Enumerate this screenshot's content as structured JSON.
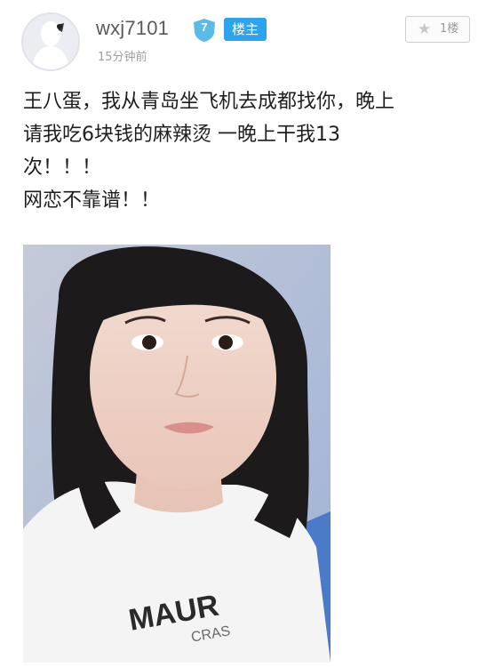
{
  "post": {
    "username": "wxj7101",
    "level": "7",
    "owner_tag": "楼主",
    "timestamp": "15分钟前",
    "floor": "1楼",
    "lines": [
      "王八蛋，我从青岛坐飞机去成都找你，晚上",
      "请我吃6块钱的麻辣烫 一晚上干我13",
      "次！！！",
      "网恋不靠谱！！"
    ],
    "shirt_text_line1": "MAUR",
    "shirt_text_line2": "CRAS"
  },
  "icons": {
    "avatar": "silhouette-avatar-icon",
    "level": "shield-badge-icon",
    "floor": "star-icon"
  },
  "colors": {
    "username": "#5a5a5a",
    "badge": "#5bbbe8",
    "owner_tag": "#2da3ee",
    "timestamp": "#a0a0a0"
  }
}
